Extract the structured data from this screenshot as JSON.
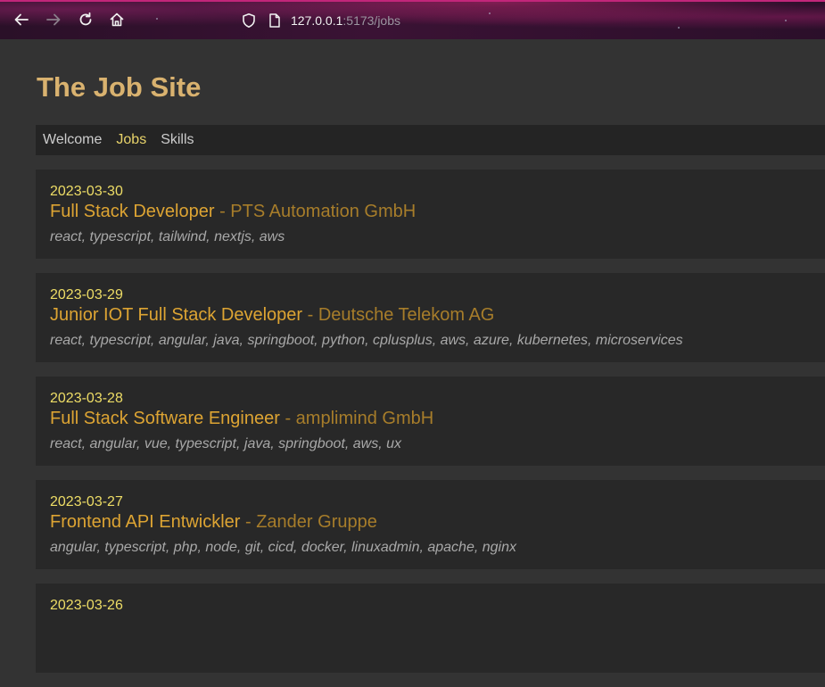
{
  "browser": {
    "url_host": "127.0.0.1",
    "url_rest": ":5173/jobs",
    "icons": [
      "back-arrow-icon",
      "forward-arrow-icon",
      "reload-icon",
      "home-icon",
      "shield-icon",
      "page-icon"
    ]
  },
  "site": {
    "title": "The Job Site"
  },
  "nav": {
    "items": [
      {
        "label": "Welcome"
      },
      {
        "label": "Jobs"
      },
      {
        "label": "Skills"
      }
    ],
    "active": "Jobs"
  },
  "jobs": [
    {
      "date": "2023-03-30",
      "title": "Full Stack Developer",
      "company": "- PTS Automation GmbH",
      "skills": "react, typescript, tailwind, nextjs, aws"
    },
    {
      "date": "2023-03-29",
      "title": "Junior IOT Full Stack Developer",
      "company": "- Deutsche Telekom AG",
      "skills": "react, typescript, angular, java, springboot, python, cplusplus, aws, azure, kubernetes, microservices"
    },
    {
      "date": "2023-03-28",
      "title": "Full Stack Software Engineer",
      "company": "- amplimind GmbH",
      "skills": "react, angular, vue, typescript, java, springboot, aws, ux"
    },
    {
      "date": "2023-03-27",
      "title": "Frontend API Entwickler",
      "company": "- Zander Gruppe",
      "skills": "angular, typescript, php, node, git, cicd, docker, linuxadmin, apache, nginx"
    },
    {
      "date": "2023-03-26",
      "title": "",
      "company": "",
      "skills": ""
    }
  ],
  "colors": {
    "accent_title": "#d9b26f",
    "active_nav": "#e8d36a",
    "job_date": "#eedd66",
    "job_title": "#dda433",
    "job_company": "#a77d2a",
    "skills": "#a8a8a8",
    "page_bg": "#333333",
    "card_bg": "#282828"
  }
}
